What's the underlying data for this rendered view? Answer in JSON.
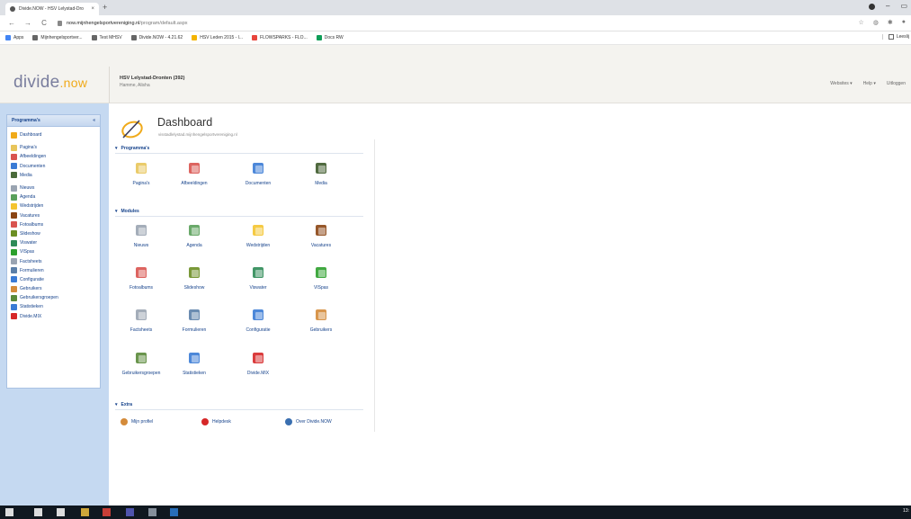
{
  "browser": {
    "tab_title": "Divide.NOW - HSV Lelystad-Dro",
    "tab_close": "×",
    "new_tab": "+",
    "url_host": "now.mijnhengelsportvereniging.nl",
    "url_path": "/program/default.aspx",
    "bookmarks": [
      {
        "label": "Apps",
        "color": "#4285f4"
      },
      {
        "label": "Mijnhengelsportver...",
        "color": "#666"
      },
      {
        "label": "Test MHSV",
        "color": "#666"
      },
      {
        "label": "Divide.NOW - 4.21.62",
        "color": "#666"
      },
      {
        "label": "HSV Leden 2015 - l...",
        "color": "#f4b400"
      },
      {
        "label": "FLOWSPARKS - FLO...",
        "color": "#e8453c"
      },
      {
        "label": "Docs RW",
        "color": "#0f9d58"
      }
    ],
    "bookmarks_right": "Leeslij"
  },
  "header": {
    "logo_main": "divide",
    "logo_dot": ".",
    "logo_suffix": "now",
    "org_name": "HSV Lelystad-Dronten (392)",
    "org_user": "Hamme, Alisha",
    "nav": [
      "Websites ▾",
      "Help ▾",
      "Uitloggen"
    ]
  },
  "sidebar": {
    "title": "Programma's",
    "toggle": "«",
    "items": [
      {
        "label": "Dashboard",
        "color": "#f0aa1a",
        "group_start": false
      },
      {
        "label": "Pagina's",
        "color": "#e8c55a",
        "group_start": true
      },
      {
        "label": "Afbeeldingen",
        "color": "#d9534f",
        "group_start": false
      },
      {
        "label": "Documenten",
        "color": "#3a7bd5",
        "group_start": false
      },
      {
        "label": "Media",
        "color": "#4a6a3a",
        "group_start": false
      },
      {
        "label": "Nieuws",
        "color": "#9aa4b1",
        "group_start": true
      },
      {
        "label": "Agenda",
        "color": "#5aa05a",
        "group_start": false
      },
      {
        "label": "Wedstrijden",
        "color": "#f4c430",
        "group_start": false
      },
      {
        "label": "Vacatures",
        "color": "#8b4513",
        "group_start": false
      },
      {
        "label": "Fotoalbums",
        "color": "#d9534f",
        "group_start": false
      },
      {
        "label": "Slideshow",
        "color": "#6b8e23",
        "group_start": false
      },
      {
        "label": "Viswater",
        "color": "#2e8b57",
        "group_start": false
      },
      {
        "label": "VISpas",
        "color": "#2ca02c",
        "group_start": false
      },
      {
        "label": "Factsheets",
        "color": "#9aa4b1",
        "group_start": false
      },
      {
        "label": "Formulieren",
        "color": "#5b7fa8",
        "group_start": false
      },
      {
        "label": "Configuratie",
        "color": "#3a7bd5",
        "group_start": false
      },
      {
        "label": "Gebruikers",
        "color": "#d48b3a",
        "group_start": false
      },
      {
        "label": "Gebruikersgroepen",
        "color": "#5a8a3a",
        "group_start": false
      },
      {
        "label": "Statistieken",
        "color": "#3a7bd5",
        "group_start": false
      },
      {
        "label": "Divide.MIX",
        "color": "#d62728",
        "group_start": false
      }
    ]
  },
  "dashboard": {
    "title": "Dashboard",
    "subtitle": "visstadlelystad.mijnhengelsportvereniging.nl",
    "sections": {
      "programmas": {
        "label": "Programma's",
        "tiles": [
          {
            "label": "Pagina's",
            "color": "#e8c55a"
          },
          {
            "label": "Afbeeldingen",
            "color": "#d9534f"
          },
          {
            "label": "Documenten",
            "color": "#3a7bd5"
          },
          {
            "label": "Media",
            "color": "#3d5a2a"
          }
        ]
      },
      "modules": {
        "label": "Modules",
        "tiles": [
          {
            "label": "Nieuws",
            "color": "#9aa4b1"
          },
          {
            "label": "Agenda",
            "color": "#5aa05a"
          },
          {
            "label": "Wedstrijden",
            "color": "#f4c430"
          },
          {
            "label": "Vacatures",
            "color": "#8b4513"
          },
          {
            "label": "Fotoalbums",
            "color": "#d9534f"
          },
          {
            "label": "Slideshow",
            "color": "#6b8e23"
          },
          {
            "label": "Viswater",
            "color": "#2e8b57"
          },
          {
            "label": "VISpas",
            "color": "#2ca02c"
          },
          {
            "label": "Factsheets",
            "color": "#9aa4b1"
          },
          {
            "label": "Formulieren",
            "color": "#5b7fa8"
          },
          {
            "label": "Configuratie",
            "color": "#3a7bd5"
          },
          {
            "label": "Gebruikers",
            "color": "#d48b3a"
          },
          {
            "label": "Gebruikersgroepen",
            "color": "#5a8a3a"
          },
          {
            "label": "Statistieken",
            "color": "#3a7bd5"
          },
          {
            "label": "Divide.MIX",
            "color": "#d62728"
          }
        ]
      },
      "extra": {
        "label": "Extra",
        "links": [
          {
            "label": "Mijn profiel",
            "color": "#d48b3a"
          },
          {
            "label": "Helpdesk",
            "color": "#d62728"
          },
          {
            "label": "Over Divide.NOW",
            "color": "#3a6fb0"
          }
        ]
      }
    }
  },
  "taskbar": {
    "clock": "13:"
  }
}
